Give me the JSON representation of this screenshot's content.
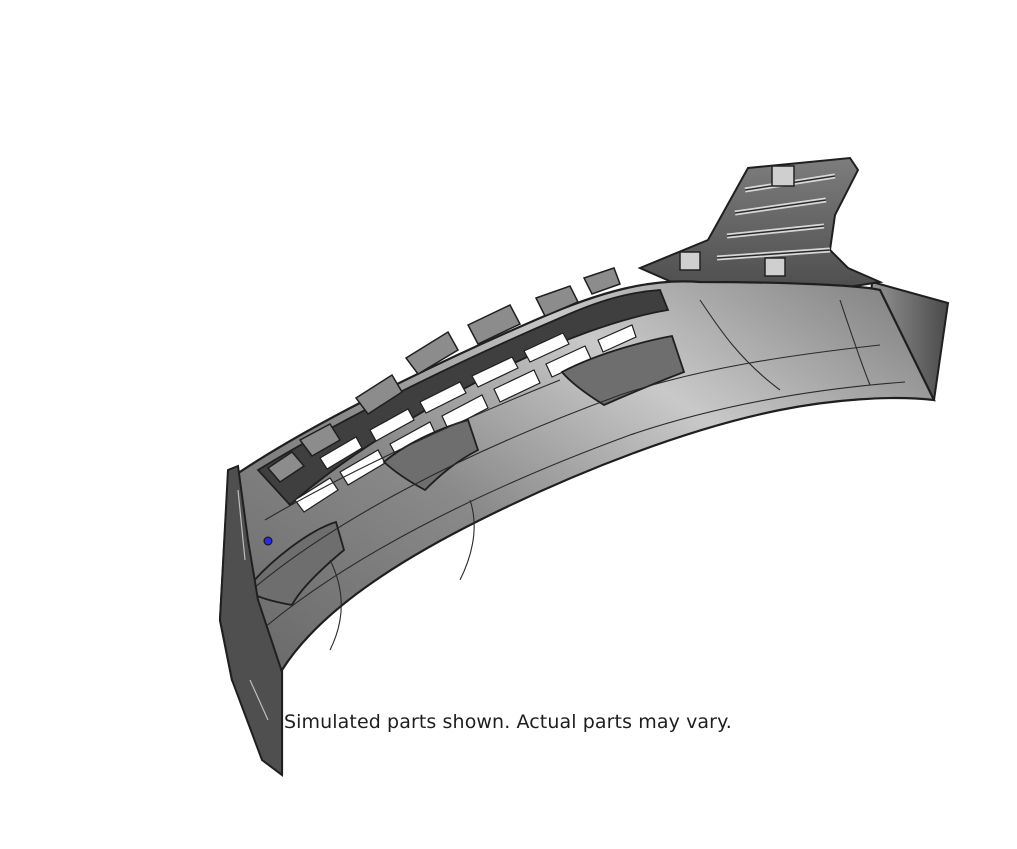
{
  "caption": {
    "disclaimer": "Simulated parts shown. Actual parts may vary."
  },
  "part": {
    "icon": "front-bumper-cover-icon"
  },
  "colors": {
    "background": "#ffffff",
    "part_dark": "#4a4a4a",
    "part_mid": "#6f6f6f",
    "part_light": "#a8a8a8",
    "outline": "#1f1f1f",
    "highlight": "#2a2adf"
  }
}
